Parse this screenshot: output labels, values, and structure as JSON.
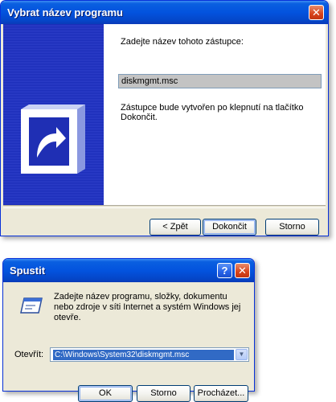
{
  "shortcut_wizard": {
    "title": "Vybrat název programu",
    "prompt_label": "Zadejte název tohoto zástupce:",
    "name_value": "diskmgmt.msc",
    "info_text": "Zástupce bude vytvořen po klepnutí na tlačítko Dokončit.",
    "back_label": "< Zpět",
    "finish_label": "Dokončit",
    "cancel_label": "Storno",
    "icons": {
      "close": "close-icon",
      "graphic": "shortcut-arrow-icon"
    }
  },
  "run_dialog": {
    "title": "Spustit",
    "description": "Zadejte název programu, složky, dokumentu nebo zdroje v síti Internet a systém Windows jej otevře.",
    "open_label": "Otevřít:",
    "open_value": "C:\\Windows\\System32\\diskmgmt.msc",
    "ok_label": "OK",
    "cancel_label": "Storno",
    "browse_label": "Procházet...",
    "icons": {
      "help": "help-icon",
      "close": "close-icon",
      "run": "run-icon",
      "dropdown": "chevron-down-icon"
    }
  },
  "colors": {
    "titlebar": "#0353de",
    "wizard_panel": "#1a2cb8",
    "window_bg": "#ece9d8",
    "selection": "#316ac5"
  }
}
